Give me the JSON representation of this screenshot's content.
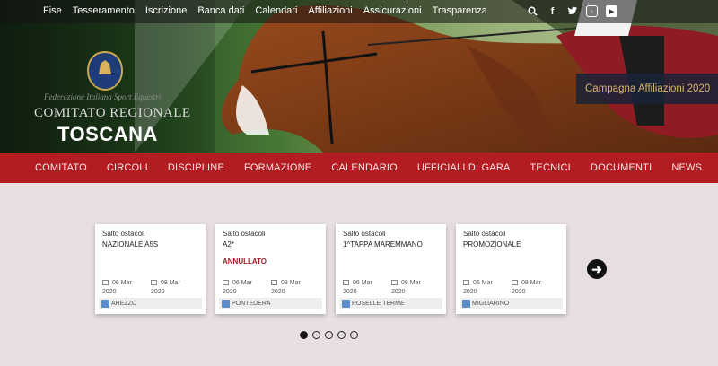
{
  "topnav": [
    "Fise",
    "Tesseramento",
    "Iscrizione",
    "Banca dati",
    "Calendari",
    "Affiliazioni",
    "Assicurazioni",
    "Trasparenza"
  ],
  "social_icons": [
    "search-icon",
    "facebook-icon",
    "twitter-icon",
    "instagram-icon",
    "youtube-icon"
  ],
  "brand": {
    "federation": "Federazione Italiana Sport Equestri",
    "committee": "COMITATO REGIONALE",
    "region": "TOSCANA",
    "logo_text": "FISE"
  },
  "campaign_label": "Campagna Affiliazioni 2020",
  "mainmenu": [
    "COMITATO",
    "CIRCOLI",
    "DISCIPLINE",
    "FORMAZIONE",
    "CALENDARIO",
    "UFFICIALI DI GARA",
    "TECNICI",
    "DOCUMENTI",
    "NEWS"
  ],
  "cards": [
    {
      "discipline": "Salto ostacoli",
      "title": "NAZIONALE A5S",
      "status": "",
      "start": "06 Mar",
      "start_year": "2020",
      "end": "08 Mar",
      "end_year": "2020",
      "location": "AREZZO"
    },
    {
      "discipline": "Salto ostacoli",
      "title": "A2*",
      "status": "ANNULLATO",
      "start": "06 Mar",
      "start_year": "2020",
      "end": "08 Mar",
      "end_year": "2020",
      "location": "PONTEDERA"
    },
    {
      "discipline": "Salto ostacoli",
      "title": "1^TAPPA MAREMMANO",
      "status": "",
      "start": "06 Mar",
      "start_year": "2020",
      "end": "08 Mar",
      "end_year": "2020",
      "location": "ROSELLE TERME"
    },
    {
      "discipline": "Salto ostacoli",
      "title": "PROMOZIONALE",
      "status": "",
      "start": "06 Mar",
      "start_year": "2020",
      "end": "08 Mar",
      "end_year": "2020",
      "location": "MIGLIARINO"
    }
  ],
  "carousel": {
    "pages": 5,
    "active": 1,
    "next_icon": "arrow-right-icon"
  },
  "colors": {
    "menu_red": "#b31d22",
    "campaign_text": "#d8b36a",
    "status_red": "#a01d22"
  }
}
